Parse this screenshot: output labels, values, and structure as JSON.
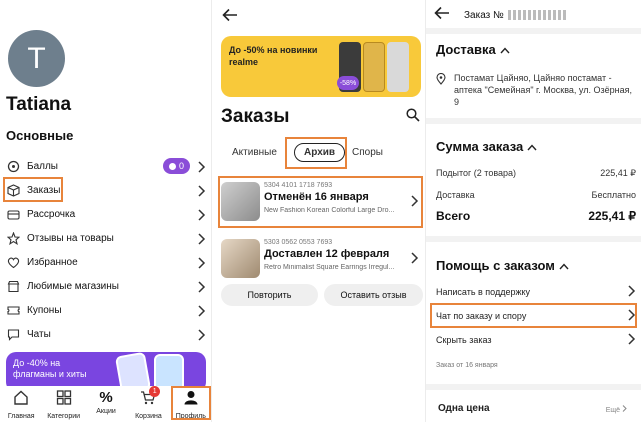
{
  "profile": {
    "avatar_letter": "T",
    "name": "Tatiana",
    "section_title": "Основные",
    "menu": [
      {
        "label": "Баллы",
        "icon": "coins-icon",
        "badge": "0"
      },
      {
        "label": "Заказы",
        "icon": "box-icon"
      },
      {
        "label": "Рассрочка",
        "icon": "card-icon"
      },
      {
        "label": "Отзывы на товары",
        "icon": "star-icon"
      },
      {
        "label": "Избранное",
        "icon": "heart-icon"
      },
      {
        "label": "Любимые магазины",
        "icon": "store-icon"
      },
      {
        "label": "Купоны",
        "icon": "coupon-icon"
      },
      {
        "label": "Чаты",
        "icon": "chat-icon"
      }
    ],
    "promo_text": "До -40% на флагманы и хиты",
    "tabbar": [
      {
        "label": "Главная",
        "icon": "home-icon"
      },
      {
        "label": "Категории",
        "icon": "grid-icon"
      },
      {
        "label": "Акции",
        "icon": "percent-icon"
      },
      {
        "label": "Корзина",
        "icon": "cart-icon",
        "badge": "1"
      },
      {
        "label": "Профиль",
        "icon": "person-icon",
        "active": true
      }
    ]
  },
  "orders": {
    "banner_text": "До -50% на новинки realme",
    "banner_badge": "-58%",
    "title": "Заказы",
    "tabs": [
      "Активные",
      "Архив",
      "Споры"
    ],
    "active_tab": "Архив",
    "items": [
      {
        "number": "5304 4101 1718 7693",
        "status": "Отменён 16 января",
        "desc": "New Fashion Korean Colorful Large Dro..."
      },
      {
        "number": "5303 0562 0553 7693",
        "status": "Доставлен 12 февраля",
        "desc": "Retro Minimalist Square Earrings Irregul..."
      }
    ],
    "buttons": {
      "repeat": "Повторить",
      "review": "Оставить отзыв"
    }
  },
  "detail": {
    "title_prefix": "Заказ №",
    "delivery": {
      "title": "Доставка",
      "address": "Постамат Цайняо, Цайняо постамат - аптека \"Семейная\" г. Москва, ул. Озёрная, 9"
    },
    "sum": {
      "title": "Сумма заказа",
      "rows": [
        {
          "label": "Подытог (2 товара)",
          "value": "225,41 ₽"
        },
        {
          "label": "Доставка",
          "value": "Бесплатно"
        }
      ],
      "total_label": "Всего",
      "total_value": "225,41 ₽"
    },
    "help": {
      "title": "Помощь с заказом",
      "items": [
        "Написать в поддержку",
        "Чат по заказу и спору",
        "Скрыть заказ"
      ]
    },
    "order_date": "Заказ от 16 января",
    "one_price": "Одна цена",
    "more": "Ещё"
  },
  "colors": {
    "highlight": "#e8843b",
    "purple": "#8a4dd8",
    "banner_yellow": "#f8c93a"
  }
}
